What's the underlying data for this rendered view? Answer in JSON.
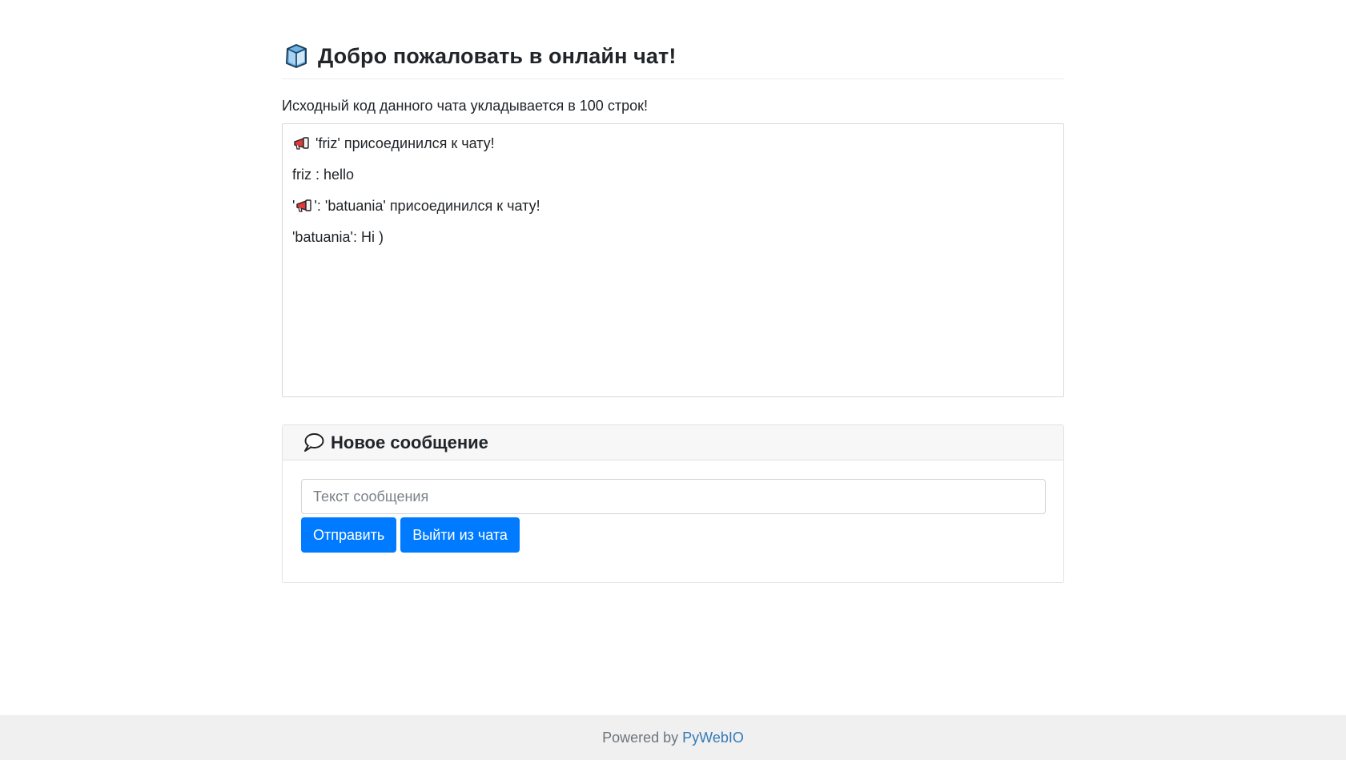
{
  "header": {
    "title": "Добро пожаловать в онлайн чат!",
    "icon": "ice-cube-icon"
  },
  "subtitle": "Исходный код данного чата укладывается в 100 строк!",
  "chat": {
    "messages": [
      {
        "prefix": "",
        "icon": "megaphone-icon",
        "text": " 'friz' присоединился к чату!"
      },
      {
        "prefix": "",
        "icon": "",
        "text": "friz : hello"
      },
      {
        "prefix": "'",
        "icon": "megaphone-icon",
        "text": "': 'batuania' присоединился к чату!"
      },
      {
        "prefix": "",
        "icon": "",
        "text": "'batuania': Hi )"
      }
    ]
  },
  "compose": {
    "title": "Новое сообщение",
    "icon": "speech-bubble-icon",
    "input_placeholder": "Текст сообщения",
    "input_value": "",
    "send_label": "Отправить",
    "leave_label": "Выйти из чата"
  },
  "footer": {
    "powered_by": "Powered by",
    "link_label": "PyWebIO"
  },
  "colors": {
    "primary": "#007bff",
    "footer_bg": "#f0f0f0",
    "link": "#337ab7"
  }
}
